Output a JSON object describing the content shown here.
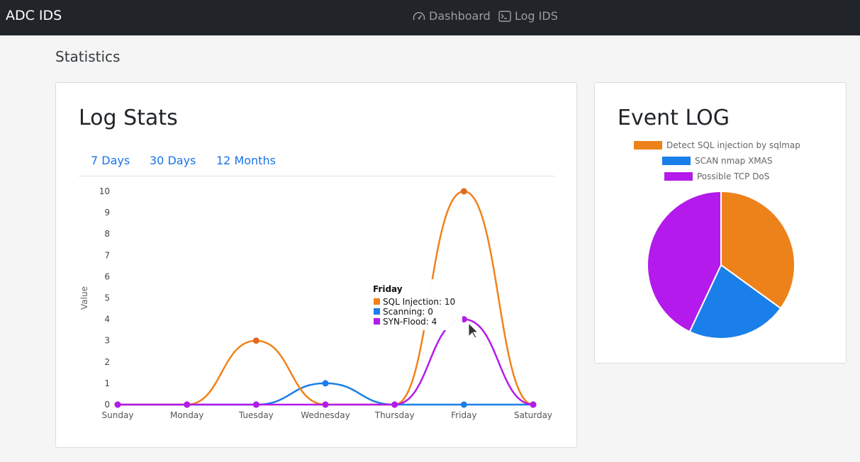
{
  "nav": {
    "brand": "ADC IDS",
    "items": [
      {
        "label": "Dashboard",
        "icon": "speedometer-icon"
      },
      {
        "label": "Log IDS",
        "icon": "terminal-icon"
      }
    ]
  },
  "page": {
    "section_title": "Statistics"
  },
  "log_stats": {
    "title": "Log Stats",
    "tabs": [
      "7 Days",
      "30 Days",
      "12 Months"
    ]
  },
  "event_log": {
    "title": "Event LOG"
  },
  "colors": {
    "orange": "#f0831a",
    "blue": "#1a7fe8",
    "purple": "#b31aeb",
    "orange_dark": "#e06a1f"
  },
  "chart_data": [
    {
      "type": "line",
      "ylabel": "Value",
      "xlabel": "",
      "categories": [
        "Sunday",
        "Monday",
        "Tuesday",
        "Wednesday",
        "Thursday",
        "Friday",
        "Saturday"
      ],
      "ylim": [
        0,
        10
      ],
      "yticks": [
        0,
        1,
        2,
        3,
        4,
        5,
        6,
        7,
        8,
        9,
        10
      ],
      "series": [
        {
          "name": "SQL Injection",
          "color": "#f0831a",
          "values": [
            0,
            0,
            3,
            0,
            0,
            10,
            0
          ]
        },
        {
          "name": "Scanning",
          "color": "#1a7fe8",
          "values": [
            0,
            0,
            0,
            1,
            0,
            0,
            0
          ]
        },
        {
          "name": "SYN-Flood",
          "color": "#b31aeb",
          "values": [
            0,
            0,
            0,
            0,
            0,
            4,
            0
          ]
        }
      ],
      "grid": false,
      "tooltip": {
        "title": "Friday",
        "lines": [
          "SQL Injection: 10",
          "Scanning: 0",
          "SYN-Flood: 4"
        ]
      }
    },
    {
      "type": "pie",
      "legend_position": "top",
      "labels": [
        "Detect SQL injection by sqlmap",
        "SCAN nmap XMAS",
        "Possible TCP DoS"
      ],
      "values": [
        35,
        22,
        43
      ],
      "colors": [
        "#ed821b",
        "#1a7fe8",
        "#b31aeb"
      ]
    }
  ]
}
